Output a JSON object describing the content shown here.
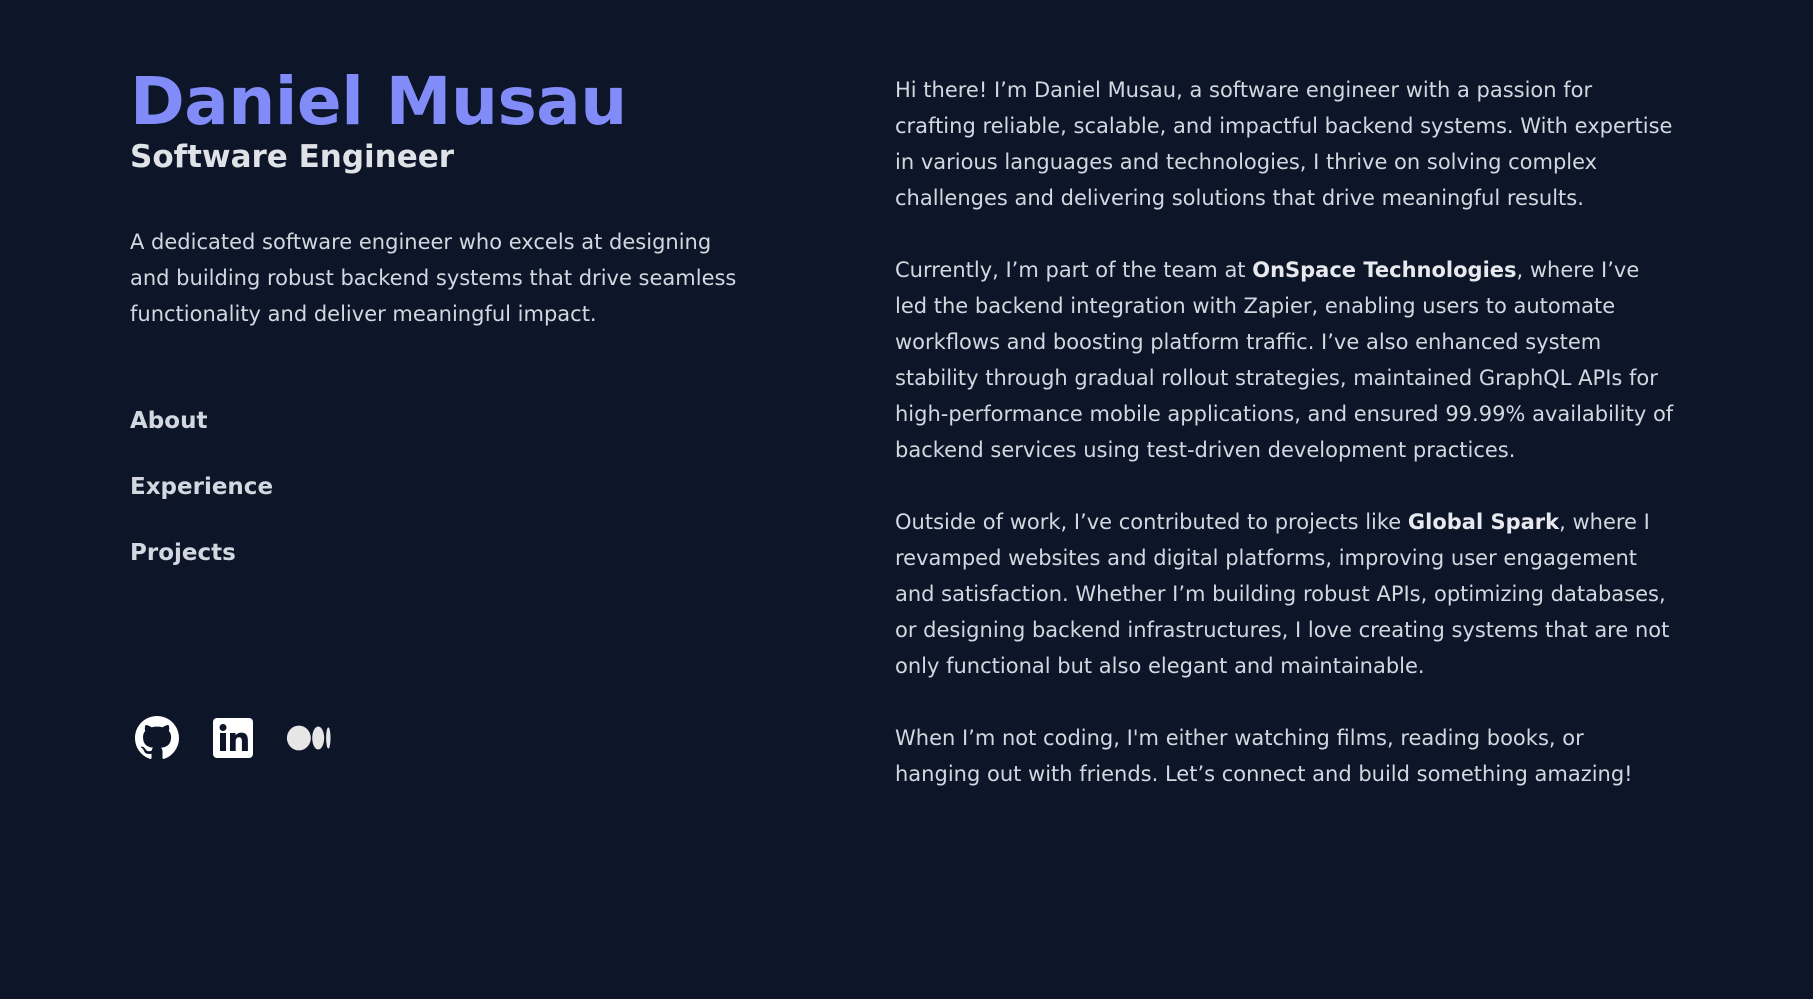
{
  "header": {
    "name": "Daniel Musau",
    "title": "Software Engineer",
    "tagline": "A dedicated software engineer who excels at designing and building robust backend systems that drive seamless functionality and deliver meaningful impact."
  },
  "nav": {
    "items": [
      {
        "label": "About"
      },
      {
        "label": "Experience"
      },
      {
        "label": "Projects"
      }
    ]
  },
  "socials": [
    {
      "icon": "github-icon",
      "label": "GitHub"
    },
    {
      "icon": "linkedin-icon",
      "label": "LinkedIn"
    },
    {
      "icon": "medium-icon",
      "label": "Medium"
    }
  ],
  "about": {
    "p1": "Hi there! I’m Daniel Musau, a software engineer with a passion for crafting reliable, scalable, and impactful backend systems. With expertise in various languages and technologies, I thrive on solving complex challenges and delivering solutions that drive meaningful results.",
    "p2_before": "Currently, I’m part of the team at ",
    "p2_company": "OnSpace Technologies",
    "p2_after": ", where I’ve led the backend integration with Zapier, enabling users to automate workflows and boosting platform traffic. I’ve also enhanced system stability through gradual rollout strategies, maintained GraphQL APIs for high-performance mobile applications, and ensured 99.99% availability of backend services using test-driven development practices.",
    "p3_before": "Outside of work, I’ve contributed to projects like ",
    "p3_project": "Global Spark",
    "p3_after": ", where I revamped websites and digital platforms, improving user engagement and satisfaction. Whether I’m building robust APIs, optimizing databases, or designing backend infrastructures, I love creating systems that are not only functional but also elegant and maintainable.",
    "p4": "When I’m not coding, I'm either watching films, reading books, or hanging out with friends. Let’s connect and build something amazing!"
  },
  "colors": {
    "background": "#0d1628",
    "accent": "#818cf8",
    "text": "#d3d7df",
    "icon": "#ffffff"
  }
}
